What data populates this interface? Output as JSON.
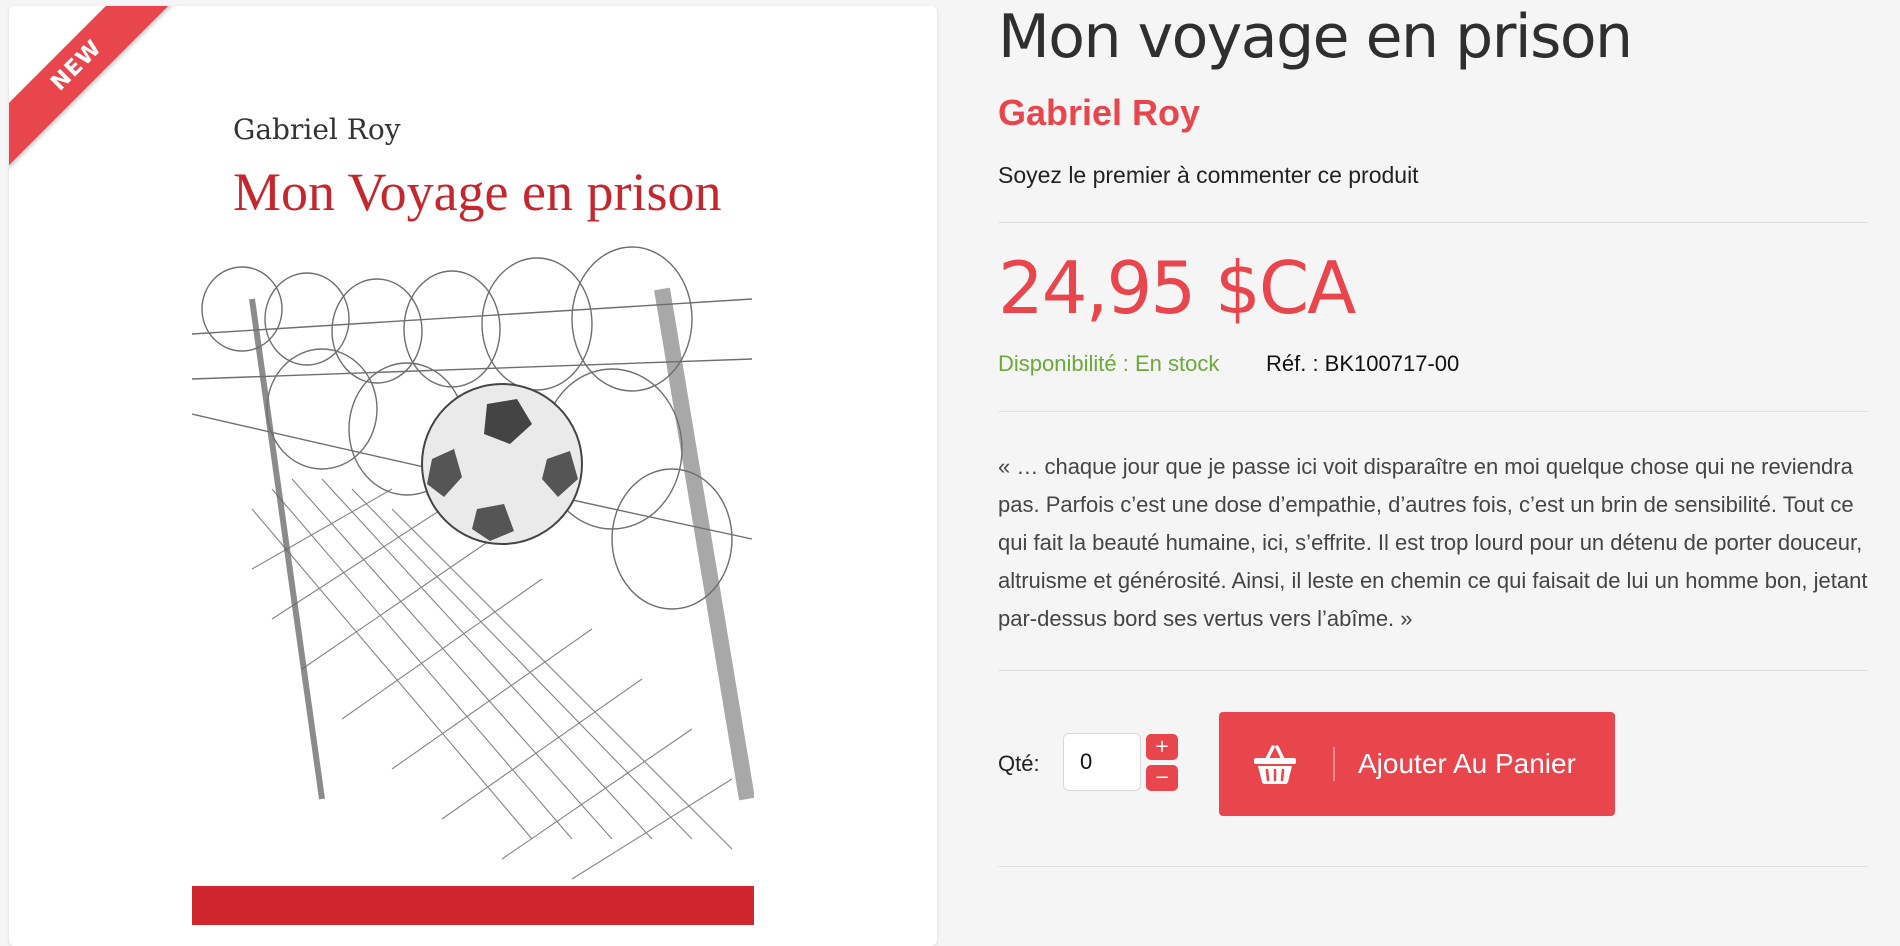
{
  "badge": {
    "label": "NEW"
  },
  "cover": {
    "author": "Gabriel Roy",
    "title": "Mon Voyage en prison"
  },
  "product": {
    "title": "Mon voyage en prison",
    "author": "Gabriel Roy",
    "review_prompt": "Soyez le premier à commenter ce produit",
    "price": "24,95 $CA",
    "availability": "Disponibilité : En stock",
    "reference": "Réf. : BK100717-00",
    "description": "« … chaque jour que je passe ici voit disparaître en moi quelque chose qui ne reviendra pas. Parfois c’est une dose d’empathie, d’autres fois, c’est un brin de sensibilité. Tout ce qui fait la beauté humaine, ici, s’effrite. Il est trop lourd pour un détenu de porter douceur, altruisme et générosité. Ainsi, il leste en chemin ce qui faisait de lui un homme bon, jetant par-dessus bord ses vertus vers l’abîme. »"
  },
  "cart": {
    "qty_label": "Qté:",
    "qty_value": "0",
    "plus_label": "+",
    "minus_label": "−",
    "button_label": "Ajouter Au Panier",
    "icon": "basket-icon"
  },
  "colors": {
    "accent": "#e8454c",
    "availability": "#6aaa37",
    "cover_title": "#c4282e",
    "cover_band": "#cf252d"
  }
}
